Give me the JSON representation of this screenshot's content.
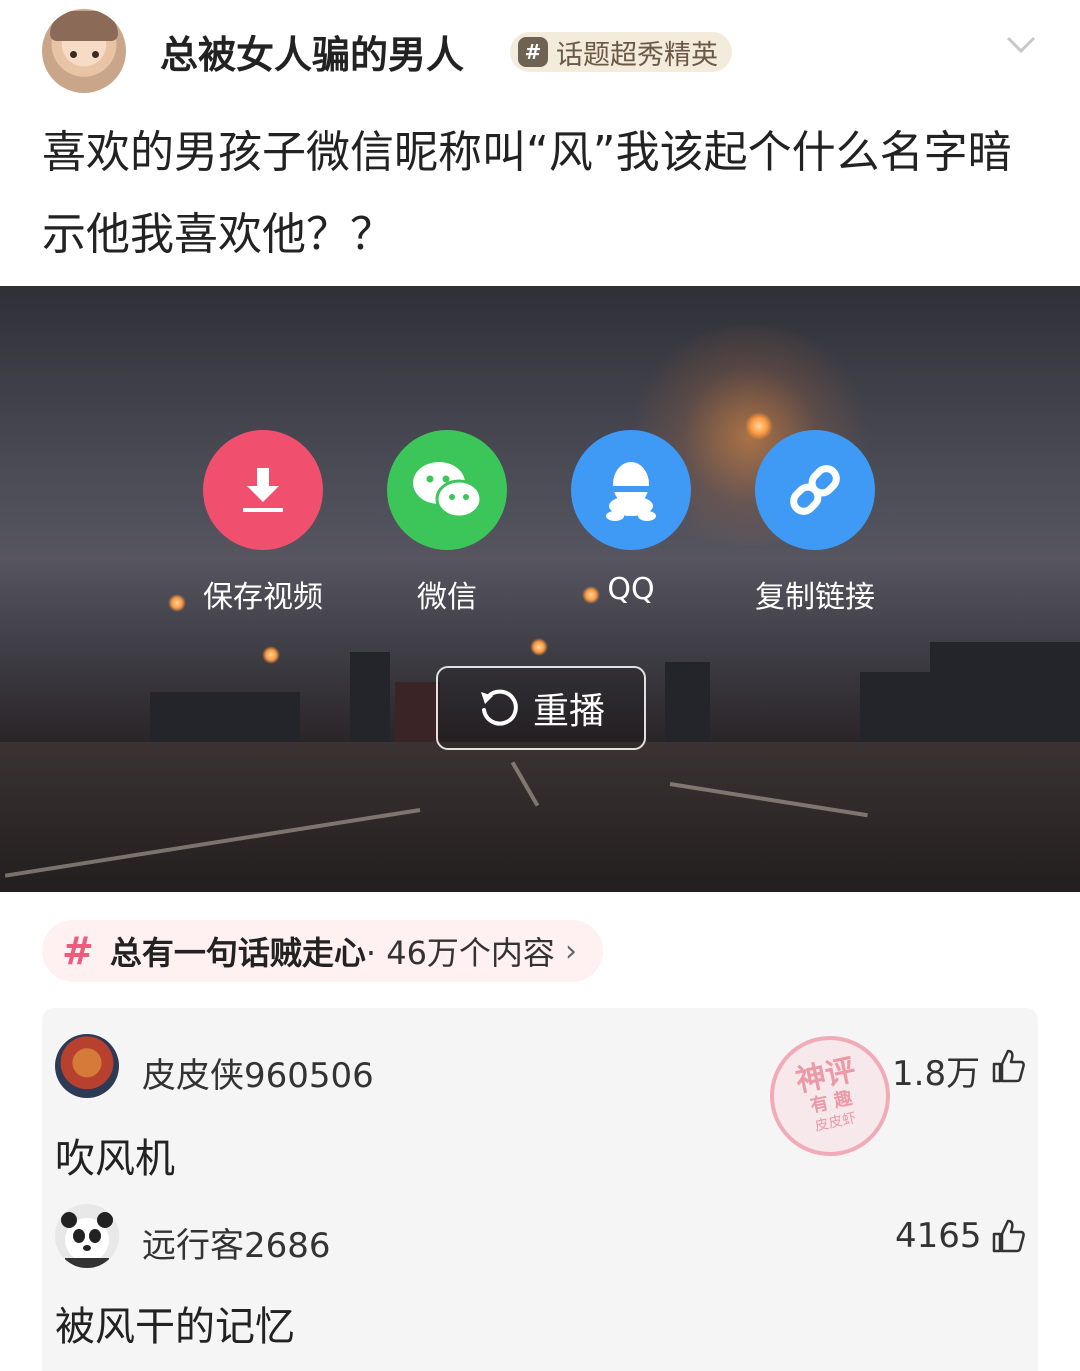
{
  "post": {
    "username": "总被女人骗的男人",
    "badge_icon": "#",
    "badge_label": "话题超秀精英",
    "text": "喜欢的男孩子微信昵称叫“风”我该起个什么名字暗示他我喜欢他？？"
  },
  "video": {
    "share_options": [
      {
        "label": "保存视频",
        "icon": "download-icon",
        "color": "#f0506e"
      },
      {
        "label": "微信",
        "icon": "wechat-icon",
        "color": "#3cc65a"
      },
      {
        "label": "QQ",
        "icon": "qq-icon",
        "color": "#3f9af5"
      },
      {
        "label": "复制链接",
        "icon": "link-icon",
        "color": "#3f9af5"
      }
    ],
    "replay_label": "重播"
  },
  "topic": {
    "hash": "#",
    "name": "总有一句话贼走心",
    "count": " · 46万个内容",
    "arrow": "›"
  },
  "comments": [
    {
      "user": "皮皮侠960506",
      "likes": "1.8万",
      "text": "吹风机"
    },
    {
      "user": "远行客2686",
      "likes": "4165",
      "text": "被风干的记忆"
    }
  ],
  "stamp": {
    "line1": "神评",
    "line2": "有 趣",
    "line3": "皮皮虾"
  },
  "colors": {
    "accent_pink": "#ef5b7d",
    "badge_bg": "#f3ebdc",
    "topic_bg": "#fff0f2"
  }
}
